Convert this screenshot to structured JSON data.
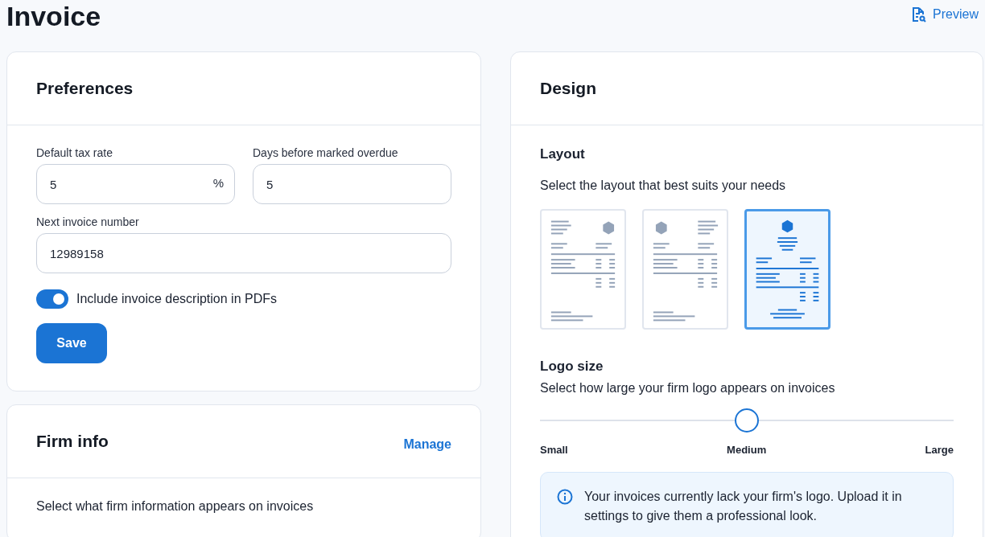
{
  "page": {
    "title": "Invoice",
    "preview_link": "Preview"
  },
  "preferences": {
    "title": "Preferences",
    "fields": [
      {
        "label": "Default tax rate",
        "value": "5",
        "suffix": "%"
      },
      {
        "label": "Days before marked overdue",
        "value": "5"
      },
      {
        "label": "Next invoice number",
        "value": "12989158"
      }
    ],
    "toggle": {
      "label": "Include invoice description in PDFs",
      "on": true
    },
    "save_button": "Save"
  },
  "firm_info": {
    "title": "Firm info",
    "manage_link": "Manage",
    "description": "Select what firm information appears on invoices"
  },
  "design": {
    "title": "Design",
    "layout": {
      "title": "Layout",
      "description": "Select the layout that best suits your needs",
      "options": [
        {
          "kind": "logo-right",
          "selected": false
        },
        {
          "kind": "logo-left",
          "selected": false
        },
        {
          "kind": "centered",
          "selected": true
        }
      ]
    },
    "logo_size": {
      "title": "Logo size",
      "description": "Select how large your firm logo appears on invoices",
      "level": 0.5,
      "labels": [
        "Small",
        "Medium",
        "Large"
      ]
    },
    "notice": "Your invoices currently lack your firm's logo. Upload it in settings to give them a professional look."
  }
}
